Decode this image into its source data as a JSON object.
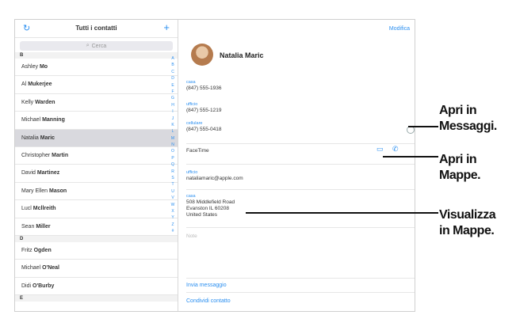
{
  "sidebar": {
    "title": "Tutti i contatti",
    "refresh_icon": "↻",
    "plus_icon": "+",
    "search_placeholder": "Cerca",
    "sections": [
      {
        "letter": "B",
        "items": [
          {
            "first": "Ashley",
            "last": "Mo"
          },
          {
            "first": "Al",
            "last": "Mukerjee"
          },
          {
            "first": "Kelly",
            "last": "Warden"
          },
          {
            "first": "Michael",
            "last": "Manning"
          },
          {
            "first": "Natalia",
            "last": "Maric"
          },
          {
            "first": "Christopher",
            "last": "Martin"
          },
          {
            "first": "David",
            "last": "Martinez"
          },
          {
            "first": "Mary Ellen",
            "last": "Mason"
          },
          {
            "first": "Lucl",
            "last": "Mcllreith"
          },
          {
            "first": "Sean",
            "last": "Miller"
          }
        ]
      },
      {
        "letter": "D",
        "items": [
          {
            "first": "Fritz",
            "last": "Ogden"
          },
          {
            "first": "Michael",
            "last": "O'Neal"
          },
          {
            "first": "Didi",
            "last": "O'Burby"
          }
        ]
      },
      {
        "letter": "E",
        "items": []
      }
    ],
    "index_letters": [
      "A",
      "B",
      "C",
      "D",
      "E",
      "F",
      "G",
      "H",
      "I",
      "J",
      "K",
      "L",
      "M",
      "N",
      "O",
      "P",
      "Q",
      "R",
      "S",
      "T",
      "U",
      "V",
      "W",
      "X",
      "Y",
      "Z",
      "#"
    ]
  },
  "detail": {
    "edit_label": "Modifica",
    "name": "Natalia Maric",
    "fields": [
      {
        "label": "casa",
        "value": "(847) 555-1936"
      },
      {
        "label": "ufficio",
        "value": "(847) 555-1219"
      },
      {
        "label": "cellulare",
        "value": "(847) 555-0418"
      }
    ],
    "facetime_label": "FaceTime",
    "email": {
      "label": "ufficio",
      "value": "nataliamaric@apple.com"
    },
    "address": {
      "label": "casa",
      "line1": "508 Middlefield Road",
      "line2": "Evanston IL 60208",
      "line3": "United States"
    },
    "notes_label": "Note",
    "send_message": "Invia messaggio",
    "share_contact": "Condividi contatto"
  },
  "callouts": {
    "messages": [
      "Apri in",
      "Messaggi."
    ],
    "maps": [
      "Apri in",
      "Mappe."
    ],
    "view_maps": [
      "Visualizza",
      "in Mappe."
    ]
  }
}
